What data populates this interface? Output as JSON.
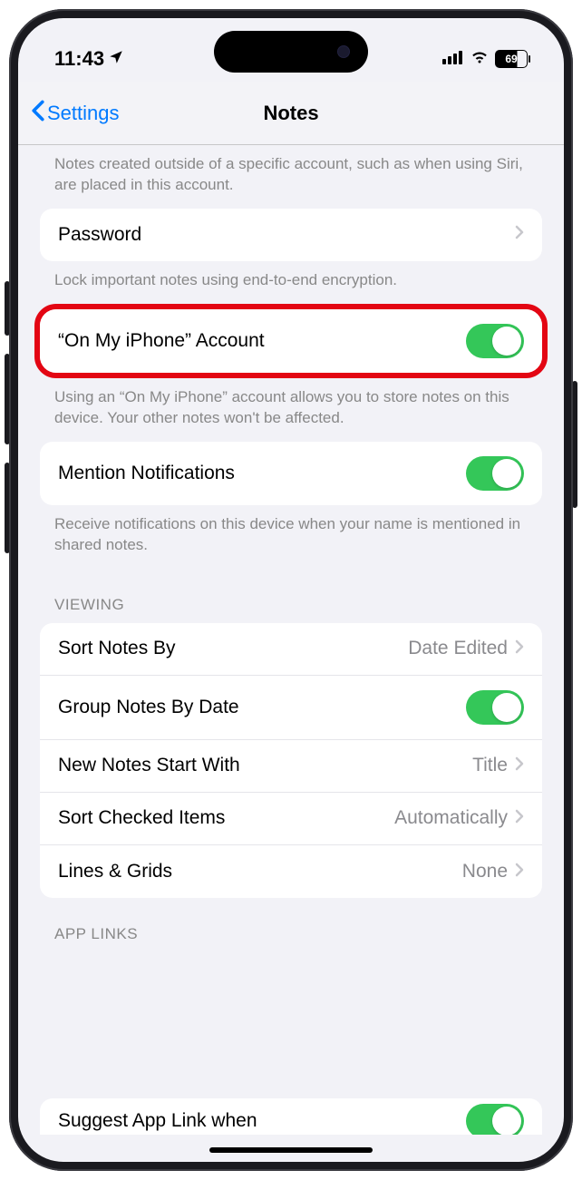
{
  "statusBar": {
    "time": "11:43",
    "battery": "69"
  },
  "nav": {
    "back": "Settings",
    "title": "Notes"
  },
  "topFooter": "Notes created outside of a specific account, such as when using Siri, are placed in this account.",
  "password": {
    "label": "Password",
    "footer": "Lock important notes using end-to-end encryption."
  },
  "onMyIphone": {
    "label": "“On My iPhone” Account",
    "enabled": true,
    "footer": "Using an “On My iPhone” account allows you to store notes on this device. Your other notes won't be affected."
  },
  "mention": {
    "label": "Mention Notifications",
    "enabled": true,
    "footer": "Receive notifications on this device when your name is mentioned in shared notes."
  },
  "viewing": {
    "header": "VIEWING",
    "items": [
      {
        "label": "Sort Notes By",
        "value": "Date Edited",
        "type": "disclosure"
      },
      {
        "label": "Group Notes By Date",
        "type": "toggle",
        "enabled": true
      },
      {
        "label": "New Notes Start With",
        "value": "Title",
        "type": "disclosure"
      },
      {
        "label": "Sort Checked Items",
        "value": "Automatically",
        "type": "disclosure"
      },
      {
        "label": "Lines & Grids",
        "value": "None",
        "type": "disclosure"
      }
    ]
  },
  "appLinks": {
    "header": "APP LINKS",
    "partial": "Suggest App Link when"
  }
}
